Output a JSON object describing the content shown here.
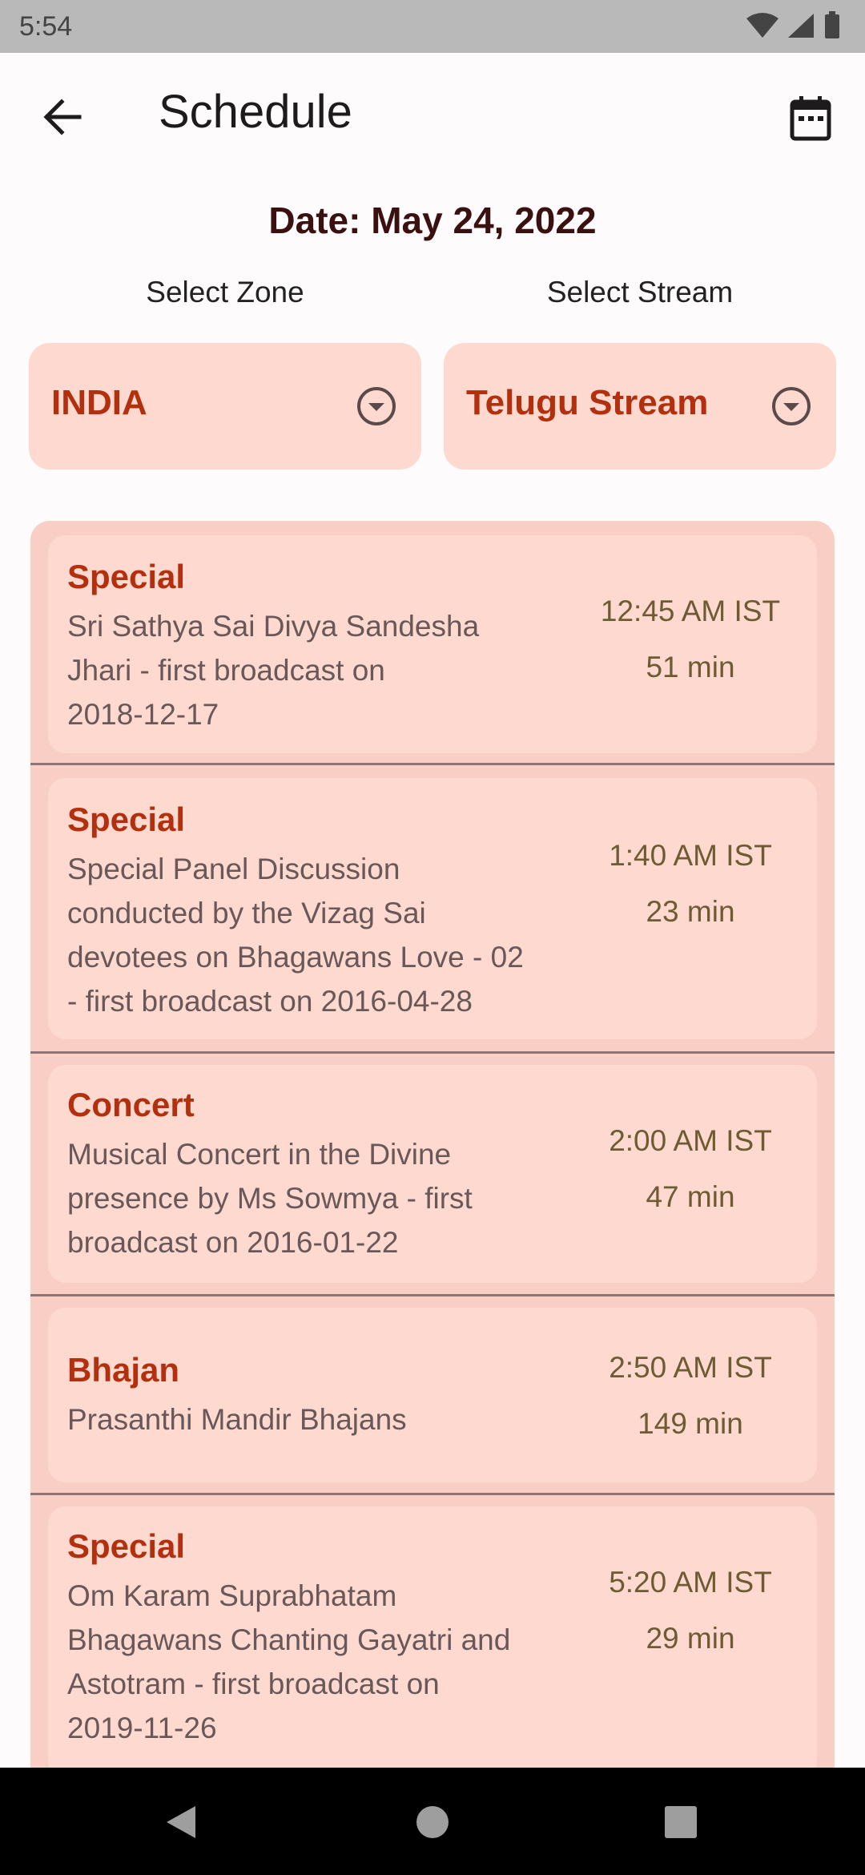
{
  "status": {
    "time": "5:54"
  },
  "header": {
    "title": "Schedule"
  },
  "date_label": "Date: May 24, 2022",
  "filters": {
    "zone_label": "Select Zone",
    "zone_value": "INDIA",
    "stream_label": "Select Stream",
    "stream_value": "Telugu Stream"
  },
  "schedule": [
    {
      "category": "Special",
      "desc_lines": [
        "Sri Sathya Sai Divya Sandesha",
        "Jhari - first broadcast on",
        "2018-12-17"
      ],
      "time": "12:45 AM IST",
      "duration": "51 min"
    },
    {
      "category": "Special",
      "desc_lines": [
        "Special Panel Discussion",
        "conducted by the Vizag Sai",
        "devotees on Bhagawans Love - 02",
        "- first broadcast on 2016-04-28"
      ],
      "time": "1:40 AM IST",
      "duration": "23 min"
    },
    {
      "category": "Concert",
      "desc_lines": [
        "Musical Concert in the Divine",
        "presence by Ms Sowmya - first",
        "broadcast on 2016-01-22"
      ],
      "time": "2:00 AM IST",
      "duration": "47 min"
    },
    {
      "category": "Bhajan",
      "desc_lines": [
        "Prasanthi Mandir Bhajans"
      ],
      "time": "2:50 AM IST",
      "duration": "149 min"
    },
    {
      "category": "Special",
      "desc_lines": [
        "Om Karam Suprabhatam",
        "Bhagawans Chanting Gayatri and",
        "Astotram - first broadcast on",
        "2019-11-26"
      ],
      "time": "5:20 AM IST",
      "duration": "29 min"
    }
  ],
  "colors": {
    "accent": "#b3300f",
    "card": "#fdd9d0",
    "list_bg": "#f9cfc5"
  },
  "icons": [
    "back-arrow-icon",
    "calendar-icon",
    "dropdown-circle-icon",
    "wifi-icon",
    "signal-icon",
    "battery-icon",
    "nav-back-icon",
    "nav-home-icon",
    "nav-recents-icon"
  ]
}
